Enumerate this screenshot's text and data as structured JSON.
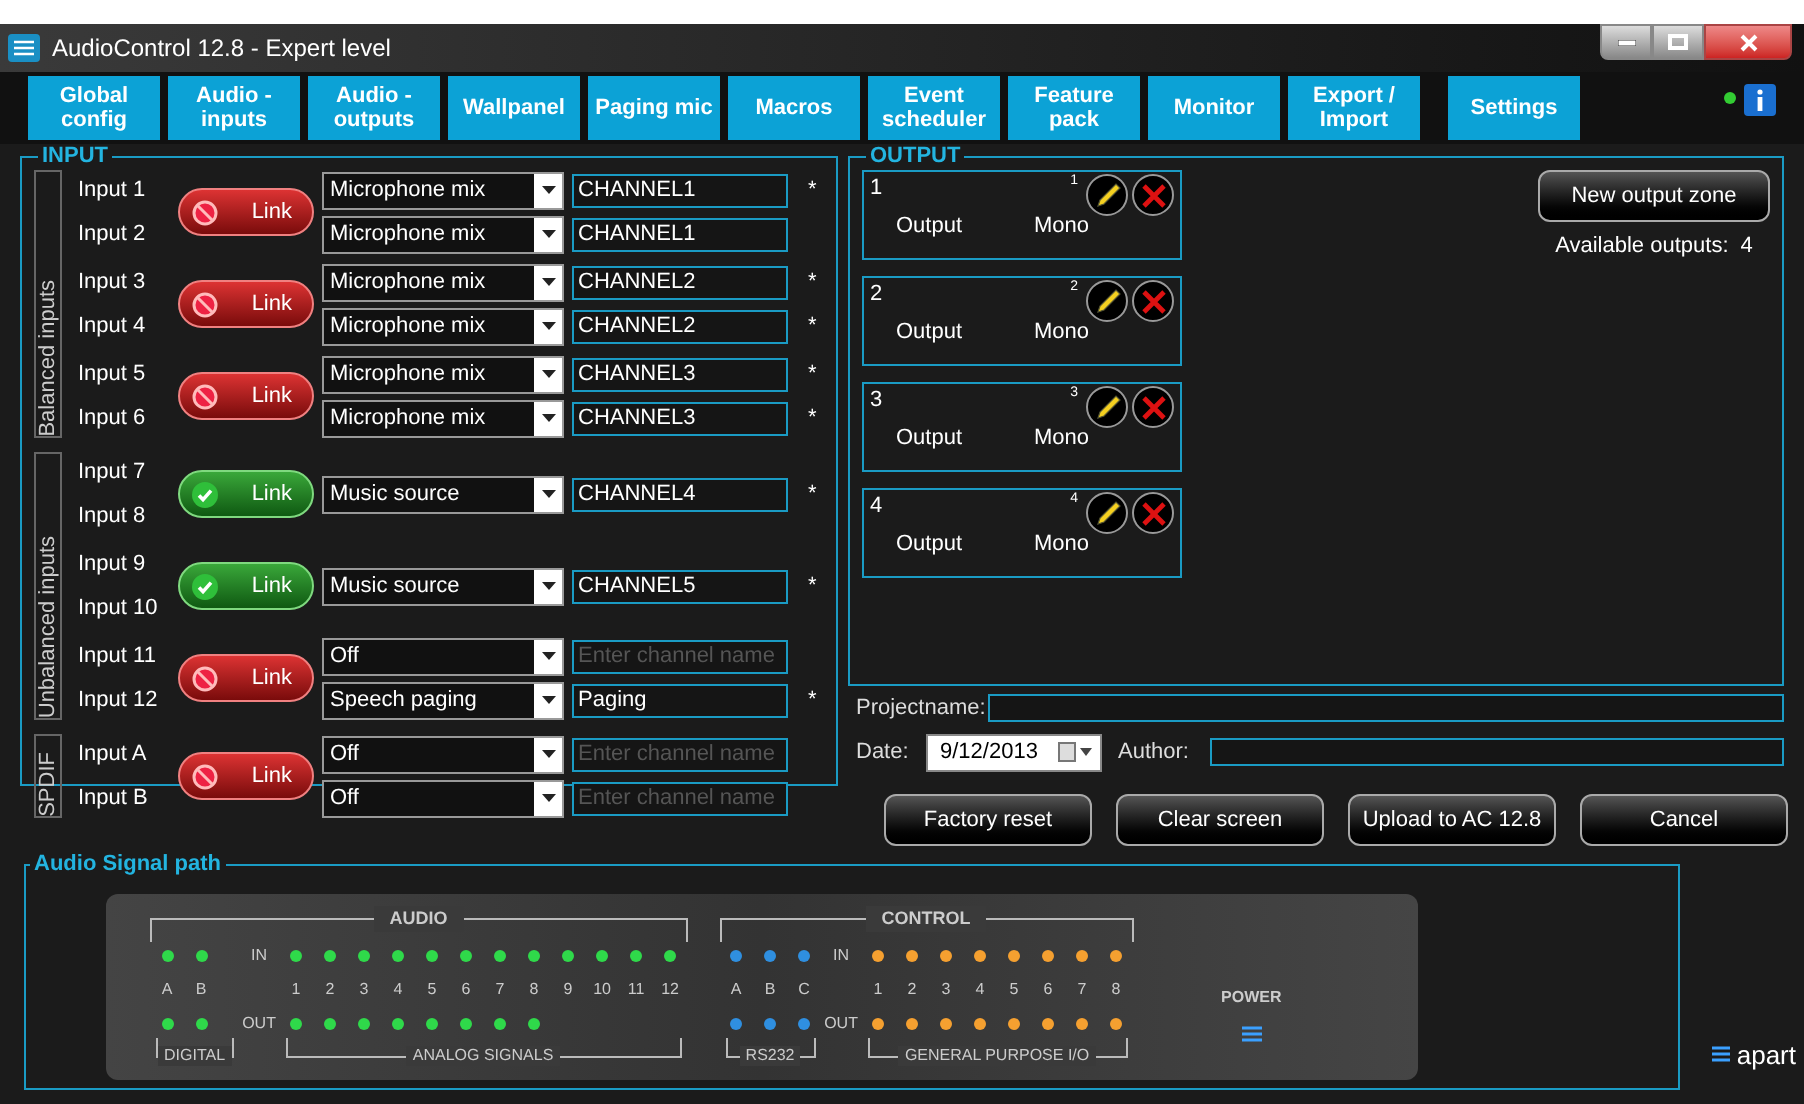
{
  "window": {
    "title": "AudioControl 12.8 - Expert level"
  },
  "tabs": [
    {
      "label": "Global config",
      "selected": false
    },
    {
      "label": "Audio - inputs",
      "selected": false
    },
    {
      "label": "Audio - outputs",
      "selected": false
    },
    {
      "label": "Wallpanel",
      "selected": false
    },
    {
      "label": "Paging mic",
      "selected": false
    },
    {
      "label": "Macros",
      "selected": false
    },
    {
      "label": "Event scheduler",
      "selected": false
    },
    {
      "label": "Feature pack",
      "selected": false
    },
    {
      "label": "Monitor",
      "selected": false
    },
    {
      "label": "Export / Import",
      "selected": false
    },
    {
      "label": "Settings",
      "selected": false
    }
  ],
  "input": {
    "title": "INPUT",
    "groups": [
      {
        "label": "Balanced inputs",
        "pairs": [
          {
            "labels": [
              "Input 1",
              "Input 2"
            ],
            "link_label": "Link",
            "linked": false,
            "rows": [
              {
                "source": "Microphone mix",
                "name": "CHANNEL1",
                "flag": "*"
              },
              {
                "source": "Microphone mix",
                "name": "CHANNEL1"
              }
            ]
          },
          {
            "labels": [
              "Input 3",
              "Input 4"
            ],
            "link_label": "Link",
            "linked": false,
            "rows": [
              {
                "source": "Microphone mix",
                "name": "CHANNEL2",
                "flag": "*"
              },
              {
                "source": "Microphone mix",
                "name": "CHANNEL2",
                "flag": "*"
              }
            ]
          },
          {
            "labels": [
              "Input 5",
              "Input 6"
            ],
            "link_label": "Link",
            "linked": false,
            "rows": [
              {
                "source": "Microphone mix",
                "name": "CHANNEL3",
                "flag": "*"
              },
              {
                "source": "Microphone mix",
                "name": "CHANNEL3",
                "flag": "*"
              }
            ]
          }
        ]
      },
      {
        "label": "Unbalanced inputs",
        "pairs": [
          {
            "labels": [
              "Input 7",
              "Input 8"
            ],
            "link_label": "Link",
            "linked": true,
            "rows": [
              {
                "source": "Music source",
                "name": "CHANNEL4",
                "flag": "*"
              }
            ]
          },
          {
            "labels": [
              "Input 9",
              "Input 10"
            ],
            "link_label": "Link",
            "linked": true,
            "rows": [
              {
                "source": "Music source",
                "name": "CHANNEL5",
                "flag": "*"
              }
            ]
          },
          {
            "labels": [
              "Input 11",
              "Input 12"
            ],
            "link_label": "Link",
            "linked": false,
            "rows": [
              {
                "source": "Off",
                "placeholder": "Enter channel name"
              },
              {
                "source": "Speech paging",
                "name": "Paging",
                "flag": "*"
              }
            ]
          }
        ]
      },
      {
        "label": "SPDIF",
        "pairs": [
          {
            "labels": [
              "Input A",
              "Input B"
            ],
            "link_label": "Link",
            "linked": false,
            "rows": [
              {
                "source": "Off",
                "placeholder": "Enter channel name"
              },
              {
                "source": "Off",
                "placeholder": "Enter channel name"
              }
            ]
          }
        ]
      }
    ]
  },
  "output": {
    "title": "OUTPUT",
    "zones": [
      {
        "number": "1",
        "corner": "1",
        "label": "Output",
        "mode": "Mono"
      },
      {
        "number": "2",
        "corner": "2",
        "label": "Output",
        "mode": "Mono"
      },
      {
        "number": "3",
        "corner": "3",
        "label": "Output",
        "mode": "Mono"
      },
      {
        "number": "4",
        "corner": "4",
        "label": "Output",
        "mode": "Mono"
      }
    ],
    "new_zone_button": "New output zone",
    "available_label": "Available outputs:",
    "available_count": "4"
  },
  "project": {
    "name_label": "Projectname:",
    "date_label": "Date:",
    "date": "9/12/2013",
    "author_label": "Author:"
  },
  "buttons": [
    "Factory reset",
    "Clear screen",
    "Upload to AC 12.8",
    "Cancel"
  ],
  "signal_path": {
    "title": "Audio Signal path",
    "power_label": "POWER",
    "sections": [
      {
        "title": "AUDIO",
        "in_label": "IN",
        "out_label": "OUT",
        "groups": [
          {
            "label": "DIGITAL",
            "color": "#2fd94a",
            "leds": [
              {
                "label": "A",
                "out": true
              },
              {
                "label": "B",
                "out": true
              }
            ]
          },
          {
            "label": "ANALOG SIGNALS",
            "color": "#2fd94a",
            "leds": [
              {
                "label": "1",
                "out": true
              },
              {
                "label": "2",
                "out": true
              },
              {
                "label": "3",
                "out": true
              },
              {
                "label": "4",
                "out": true
              },
              {
                "label": "5",
                "out": true
              },
              {
                "label": "6",
                "out": true
              },
              {
                "label": "7",
                "out": true
              },
              {
                "label": "8",
                "out": true
              },
              {
                "label": "9",
                "out": false
              },
              {
                "label": "10",
                "out": false
              },
              {
                "label": "11",
                "out": false
              },
              {
                "label": "12",
                "out": false
              }
            ]
          }
        ]
      },
      {
        "title": "CONTROL",
        "in_label": "IN",
        "out_label": "OUT",
        "groups": [
          {
            "label": "RS232",
            "color": "#2f8fe0",
            "leds": [
              {
                "label": "A",
                "out": true
              },
              {
                "label": "B",
                "out": true
              },
              {
                "label": "C",
                "out": true
              }
            ]
          },
          {
            "label": "GENERAL PURPOSE I/O",
            "color": "#f5a030",
            "leds": [
              {
                "label": "1",
                "out": true
              },
              {
                "label": "2",
                "out": true
              },
              {
                "label": "3",
                "out": true
              },
              {
                "label": "4",
                "out": true
              },
              {
                "label": "5",
                "out": true
              },
              {
                "label": "6",
                "out": true
              },
              {
                "label": "7",
                "out": true
              },
              {
                "label": "8",
                "out": true
              }
            ]
          }
        ]
      }
    ]
  },
  "logo": "apart"
}
